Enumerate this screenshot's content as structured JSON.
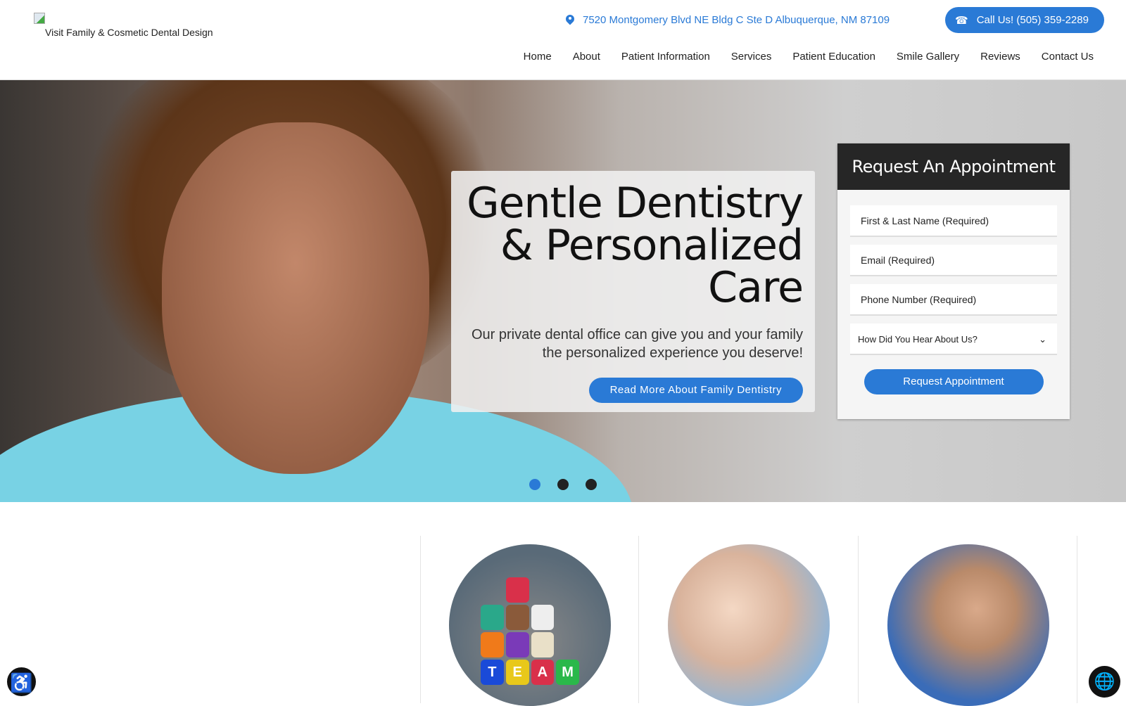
{
  "header": {
    "logo_alt": "Visit Family & Cosmetic Dental Design",
    "address": "7520 Montgomery Blvd NE Bldg C Ste D Albuquerque, NM 87109",
    "call_label": "Call Us! (505) 359-2289",
    "nav": [
      "Home",
      "About",
      "Patient Information",
      "Services",
      "Patient Education",
      "Smile Gallery",
      "Reviews",
      "Contact Us"
    ]
  },
  "hero": {
    "title": "Gentle Dentistry & Personalized Care",
    "subtitle": "Our private dental office can give you and your family the personalized experience you deserve!",
    "button": "Read More About Family Dentistry",
    "slides": 3,
    "active_slide": 1
  },
  "form": {
    "title": "Request An Appointment",
    "name_placeholder": "First & Last Name (Required)",
    "email_placeholder": "Email (Required)",
    "phone_placeholder": "Phone Number (Required)",
    "referral_select": "How Did You Hear About Us?",
    "submit": "Request Appointment"
  },
  "team_blocks": [
    "T",
    "E",
    "A",
    "M"
  ],
  "colors": {
    "accent": "#2a7ad6",
    "dark": "#262626"
  }
}
